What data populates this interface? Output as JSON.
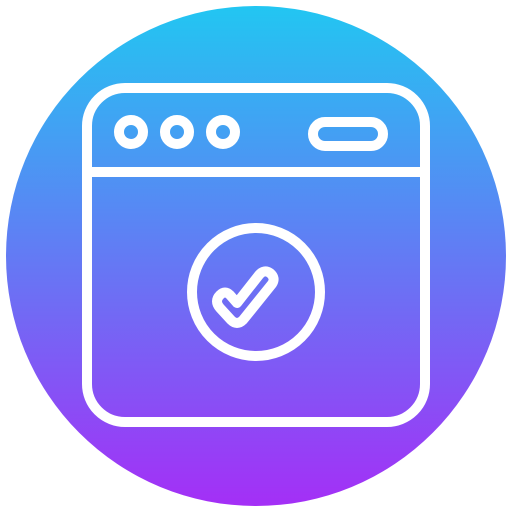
{
  "icon": {
    "name": "browser-window-check-icon",
    "colors": {
      "gradient_top": "#22c6f2",
      "gradient_bottom": "#a42ff6",
      "stroke": "#ffffff",
      "background": "#ffffff"
    },
    "parts": [
      "window-frame",
      "window-dots",
      "address-bar",
      "check-circle",
      "checkmark"
    ]
  }
}
